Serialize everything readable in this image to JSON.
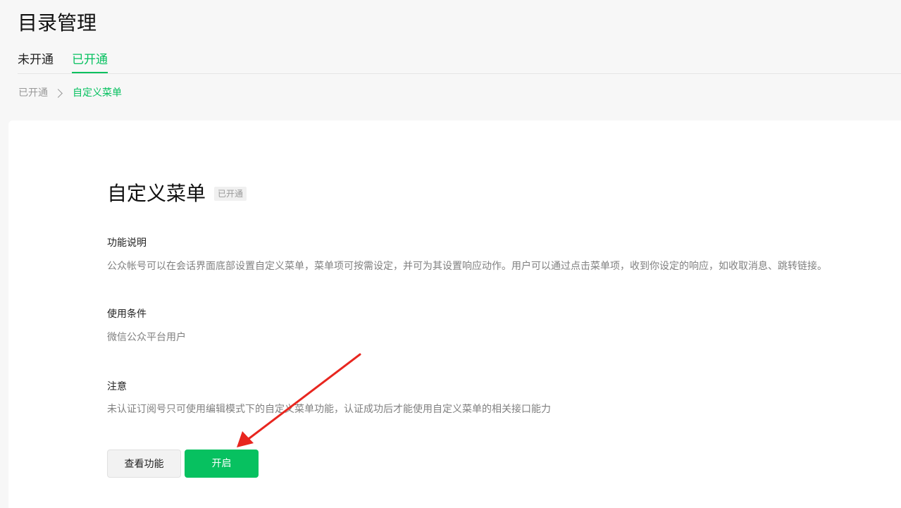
{
  "header": {
    "title": "目录管理"
  },
  "tabs": [
    {
      "label": "未开通",
      "active": false
    },
    {
      "label": "已开通",
      "active": true
    }
  ],
  "breadcrumb": {
    "parent": "已开通",
    "current": "自定义菜单"
  },
  "feature": {
    "title": "自定义菜单",
    "status": "已开通",
    "sections": [
      {
        "label": "功能说明",
        "text": "公众帐号可以在会话界面底部设置自定义菜单，菜单项可按需设定，并可为其设置响应动作。用户可以通过点击菜单项，收到你设定的响应，如收取消息、跳转链接。"
      },
      {
        "label": "使用条件",
        "text": "微信公众平台用户"
      },
      {
        "label": "注意",
        "text": "未认证订阅号只可使用编辑模式下的自定义菜单功能，认证成功后才能使用自定义菜单的相关接口能力"
      }
    ],
    "buttons": {
      "view": "查看功能",
      "enable": "开启"
    }
  },
  "colors": {
    "accent": "#07c160",
    "annotation": "#e8261f"
  }
}
